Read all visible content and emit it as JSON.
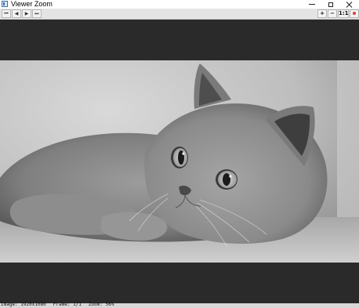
{
  "window": {
    "title": "Viewer Zoom",
    "controls": {
      "minimize": "minimize-icon",
      "maximize": "maximize-icon",
      "close": "close-icon"
    }
  },
  "toolbar": {
    "nav": [
      {
        "name": "first-frame",
        "glyph": "⏮"
      },
      {
        "name": "previous-frame",
        "glyph": "◀"
      },
      {
        "name": "next-frame",
        "glyph": "▶"
      },
      {
        "name": "last-frame",
        "glyph": "⏭"
      }
    ],
    "zoom_in_label": "+",
    "zoom_out_label": "−",
    "actual_size_label": "1:1",
    "record_color": "#e23b3b"
  },
  "image": {
    "subject": "Grey British Shorthair cat lying down, black and white photo"
  },
  "status": {
    "image": "Image: 1920x1080",
    "frame": "Frame: 1/1",
    "zoom": "Zoom: 56%"
  },
  "colors": {
    "viewer_background": "#2a2a2a",
    "toolbar": "#e4e4e4",
    "statusbar": "#d8d8d8"
  }
}
